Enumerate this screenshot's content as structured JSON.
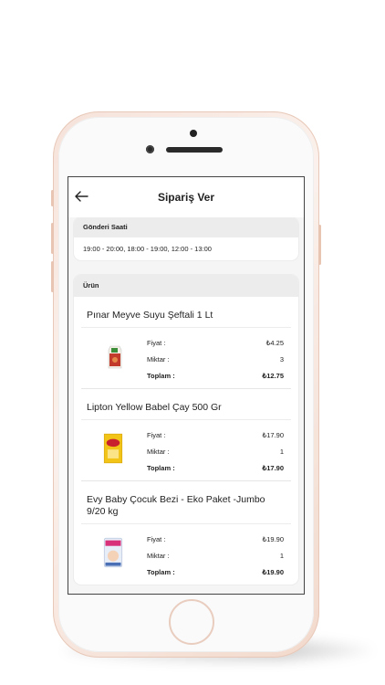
{
  "header": {
    "title": "Sipariş Ver"
  },
  "delivery": {
    "heading": "Gönderi Saati",
    "times": "19:00 - 20:00, 18:00 - 19:00, 12:00 - 13:00"
  },
  "products_section": {
    "heading": "Ürün"
  },
  "labels": {
    "price": "Fiyat :",
    "quantity": "Miktar :",
    "total": "Toplam :"
  },
  "products": [
    {
      "name": "Pınar Meyve Suyu Şeftali 1 Lt",
      "price": "₺4.25",
      "quantity": "3",
      "total": "₺12.75",
      "icon": "juice-carton-icon"
    },
    {
      "name": "Lipton Yellow Babel Çay 500 Gr",
      "price": "₺17.90",
      "quantity": "1",
      "total": "₺17.90",
      "icon": "tea-box-icon"
    },
    {
      "name": "Evy Baby Çocuk Bezi - Eko Paket -Jumbo 9/20 kg",
      "price": "₺19.90",
      "quantity": "1",
      "total": "₺19.90",
      "icon": "diaper-pack-icon"
    }
  ],
  "colors": {
    "phone_frame": "#f6e3da",
    "screen_bg": "#f5f5f5",
    "section_header": "#ececec"
  }
}
